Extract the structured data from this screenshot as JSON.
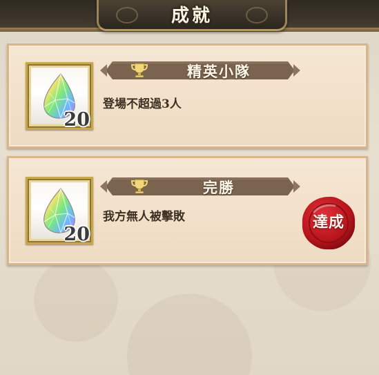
{
  "header": {
    "title": "成就"
  },
  "achievements": [
    {
      "name": "精英小隊",
      "description": "登場不超過3人",
      "reward_icon": "rainbow-crystal-icon",
      "reward_quantity": "20",
      "completed": false
    },
    {
      "name": "完勝",
      "description": "我方無人被擊敗",
      "reward_icon": "rainbow-crystal-icon",
      "reward_quantity": "20",
      "completed": true,
      "status_label": "達成"
    }
  ],
  "colors": {
    "card_background": "#f3e1cb",
    "card_border": "#d9b58c",
    "ribbon": "#7a6450",
    "seal_red": "#b8141b",
    "header_dark": "#2f2a22",
    "frame_gold": "#c7a94c"
  }
}
